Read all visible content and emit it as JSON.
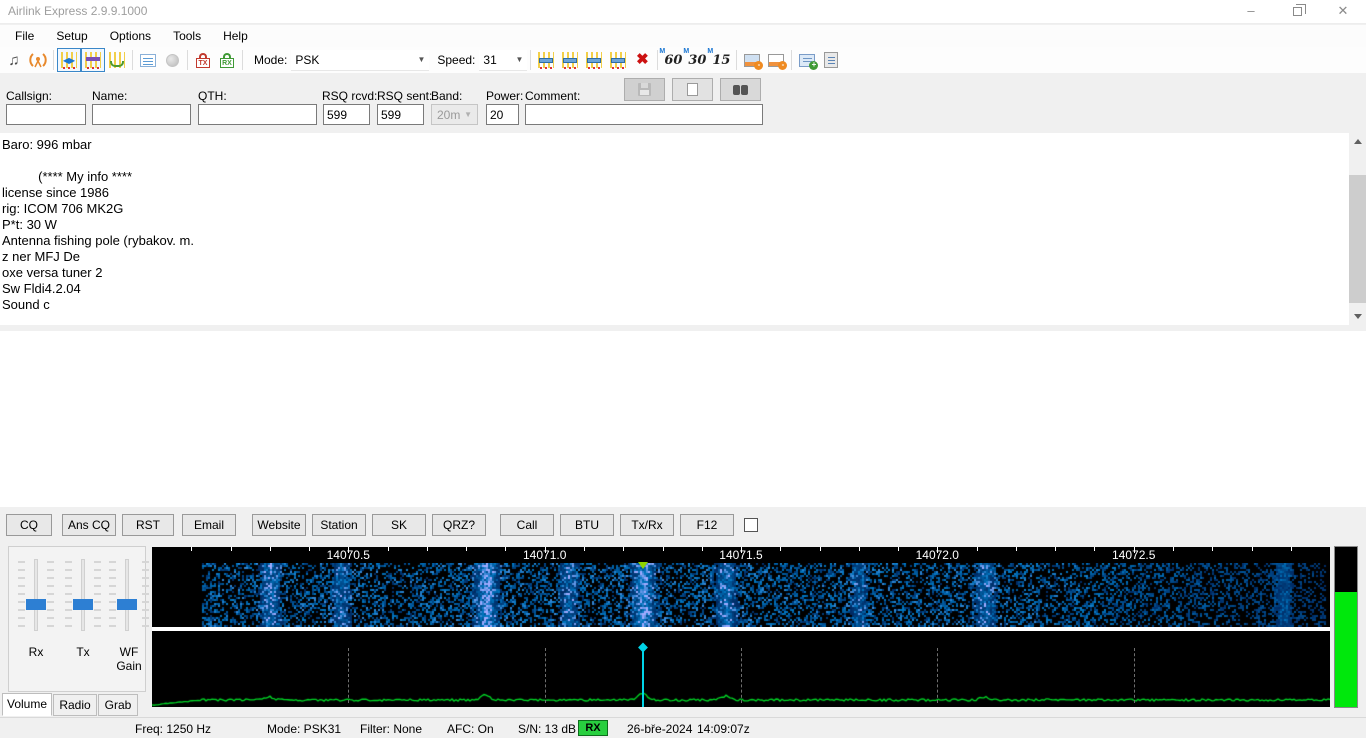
{
  "window": {
    "title": "Airlink Express 2.9.9.1000"
  },
  "menu": {
    "items": [
      "File",
      "Setup",
      "Options",
      "Tools",
      "Help"
    ]
  },
  "toolbar": {
    "mode_label": "Mode:",
    "mode_value": "PSK",
    "speed_label": "Speed:",
    "speed_value": "31",
    "timers": [
      "60",
      "30",
      "15"
    ],
    "tx_lock_text": "TX",
    "rx_lock_text": "RX"
  },
  "qso_form": {
    "fields": {
      "callsign": {
        "label": "Callsign:",
        "value": ""
      },
      "name": {
        "label": "Name:",
        "value": ""
      },
      "qth": {
        "label": "QTH:",
        "value": ""
      },
      "rsq_rcvd": {
        "label": "RSQ rcvd:",
        "value": "599"
      },
      "rsq_sent": {
        "label": "RSQ sent:",
        "value": "599"
      },
      "band": {
        "label": "Band:",
        "value": "20m"
      },
      "power": {
        "label": "Power:",
        "value": "20"
      },
      "comment": {
        "label": "Comment:",
        "value": ""
      }
    }
  },
  "rx_text": {
    "text": "Baro: 996 mbar\n\n          (**** My info ****\nlicense since 1986\nrig: ICOM 706 MK2G\nP*t: 30 W\nAntenna fishing pole (rybakov. m.\nz ner MFJ De\noxe versa tuner 2\nSw Fldi4.2.04\nSound c"
  },
  "macro_buttons": [
    "CQ",
    "Ans CQ",
    "RST",
    "Email",
    "Website",
    "Station",
    "SK",
    "QRZ?",
    "Call",
    "BTU",
    "Tx/Rx",
    "F12"
  ],
  "mixer": {
    "sliders": [
      {
        "label": "Rx"
      },
      {
        "label": "Tx"
      },
      {
        "label": "WF Gain"
      }
    ],
    "tabs": [
      "Volume",
      "Radio",
      "Grab"
    ],
    "active_tab": "Volume"
  },
  "chart_data": {
    "type": "heatmap",
    "title": "PSK waterfall and spectrum, 20m band",
    "x_start_khz": 14070.0,
    "x_end_khz": 14073.0,
    "tick_labels": [
      "14070.5",
      "14071.0",
      "14071.5",
      "14072.0",
      "14072.5"
    ],
    "tick_positions_khz": [
      14070.5,
      14071.0,
      14071.5,
      14072.0,
      14072.5
    ],
    "minor_tick_step_khz": 0.1,
    "marker_freq_hz": 1250,
    "signals_hz": [
      {
        "hz": 300,
        "intensity": 0.5
      },
      {
        "hz": 480,
        "intensity": 0.35
      },
      {
        "hz": 850,
        "intensity": 0.85
      },
      {
        "hz": 1060,
        "intensity": 0.4
      },
      {
        "hz": 1250,
        "intensity": 0.8
      },
      {
        "hz": 1460,
        "intensity": 0.55
      },
      {
        "hz": 1800,
        "intensity": 0.3
      },
      {
        "hz": 2120,
        "intensity": 0.45
      },
      {
        "hz": 2880,
        "intensity": 0.3
      }
    ],
    "spectrum_peaks": [
      {
        "hz": 300,
        "h": 3
      },
      {
        "hz": 850,
        "h": 5
      },
      {
        "hz": 1250,
        "h": 7
      },
      {
        "hz": 1460,
        "h": 4
      },
      {
        "hz": 2120,
        "h": 3
      }
    ],
    "level_meter": {
      "green_fraction": 0.72
    }
  },
  "status_bar": {
    "freq": "Freq: 1250 Hz",
    "mode": "Mode: PSK31",
    "filter": "Filter: None",
    "afc": "AFC: On",
    "snr": "S/N: 13 dB",
    "rx": "RX",
    "date": "26-bře-2024",
    "time": "14:09:07z"
  }
}
